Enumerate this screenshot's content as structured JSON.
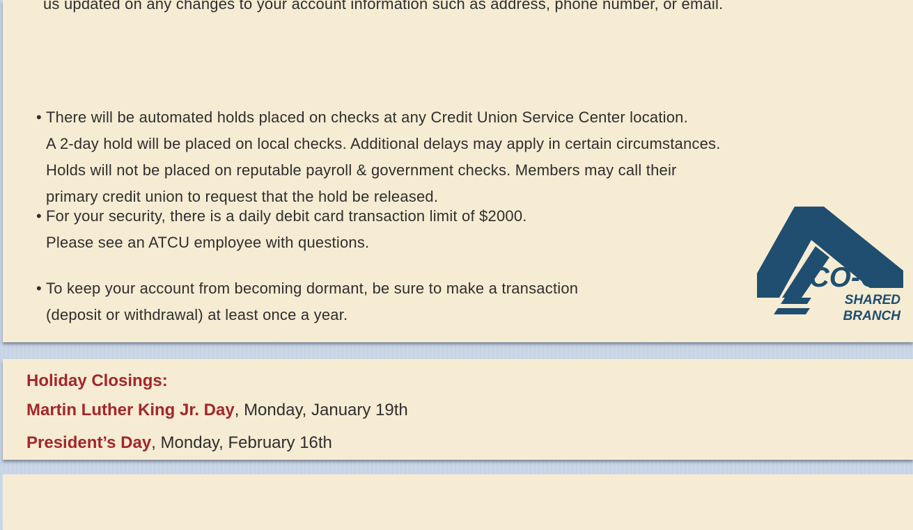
{
  "notices": {
    "intro_line": "us updated on any changes to your account information such as address, phone number, or email.",
    "bullet_char": "•",
    "bullets": [
      {
        "lines": [
          "There will be automated holds placed on checks at any Credit Union Service Center location.",
          "A 2-day hold will be placed on local checks. Additional delays may apply in certain circumstances.",
          "Holds will not be placed on reputable payroll & government checks. Members may call their",
          "primary credit union to request that the hold be released."
        ]
      },
      {
        "lines": [
          "For your security, there is a daily debit card transaction limit of $2000.",
          "Please see an ATCU employee with questions."
        ]
      },
      {
        "lines": [
          "To keep your account from becoming dormant, be sure to make a transaction",
          "(deposit or withdrawal) at least once a year."
        ]
      }
    ]
  },
  "logo": {
    "name": "co-op-shared-branch-logo",
    "line1": "CO-OP",
    "line2": "SHARED",
    "line3": "BRANCH",
    "color": "#1f4e70"
  },
  "holidays": {
    "heading": "Holiday Closings:",
    "items": [
      {
        "name": "Martin Luther King Jr. Day",
        "sep": ",",
        "date": "Monday, January 19th"
      },
      {
        "name": "President’s Day",
        "sep": ",",
        "date": "Monday, February 16th"
      }
    ]
  },
  "colors": {
    "panel_bg": "#f6ecd3",
    "accent_red": "#a3262d",
    "body_text": "#2e2e2e",
    "page_bg": "#c9d6e6"
  }
}
